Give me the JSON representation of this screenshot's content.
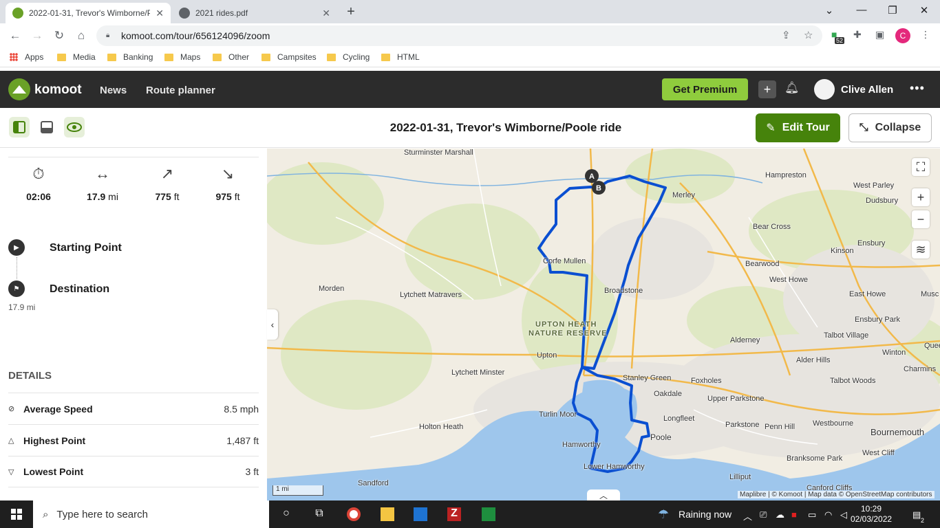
{
  "browser": {
    "tabs": [
      {
        "title": "2022-01-31, Trevor's Wimborne/P",
        "active": true
      },
      {
        "title": "2021 rides.pdf",
        "active": false
      }
    ],
    "url": "komoot.com/tour/656124096/zoom",
    "extension_badge": "52",
    "profile_initial": "C",
    "bookmarks": [
      "Apps",
      "Media",
      "Banking",
      "Maps",
      "Other",
      "Campsites",
      "Cycling",
      "HTML"
    ]
  },
  "komoot": {
    "brand": "komoot",
    "nav": [
      "News",
      "Route planner"
    ],
    "premium_label": "Get Premium",
    "user_name": "Clive Allen",
    "brand_color": "#6aa127"
  },
  "tour": {
    "title": "2022-01-31, Trevor's Wimborne/Poole ride",
    "edit_label": "Edit Tour",
    "collapse_label": "Collapse",
    "stats": {
      "duration": "02:06",
      "distance_value": "17.9",
      "distance_unit": "mi",
      "up_value": "775",
      "up_unit": "ft",
      "down_value": "975",
      "down_unit": "ft"
    },
    "waypoints": {
      "start_label": "Starting Point",
      "dest_label": "Destination",
      "dest_distance": "17.9 mi"
    },
    "details": {
      "heading": "DETAILS",
      "rows": [
        {
          "label": "Average Speed",
          "value": "8.5 mph",
          "icon": "speed-icon"
        },
        {
          "label": "Highest Point",
          "value": "1,487 ft",
          "icon": "triangle-up-icon"
        },
        {
          "label": "Lowest Point",
          "value": "3 ft",
          "icon": "triangle-down-icon"
        }
      ]
    }
  },
  "map": {
    "labels": [
      "Sturminster Marshall",
      "Hampreston",
      "West Parley",
      "Dudsbury",
      "Merley",
      "Bear Cross",
      "Kinson",
      "Ensbury",
      "Corfe Mullen",
      "Bearwood",
      "West Howe",
      "Morden",
      "Lytchett Matravers",
      "Broadstone",
      "East Howe",
      "Musc",
      "UPTON HEATH",
      "NATURE RESERVE",
      "Ensbury Park",
      "Alderney",
      "Talbot Village",
      "Upton",
      "Alder Hills",
      "Winton",
      "Quee",
      "Lytchett Minster",
      "Stanley Green",
      "Foxholes",
      "Talbot Woods",
      "Charmins",
      "Oakdale",
      "Upper Parkstone",
      "Longfleet",
      "Turlin Moor",
      "Holton Heath",
      "Parkstone",
      "Westbourne",
      "Penn Hill",
      "Bournemouth",
      "Hamworthy",
      "Poole",
      "Branksome Park",
      "West Cliff",
      "Lower Hamworthy",
      "Lilliput",
      "Sandford",
      "Canford Cliffs"
    ],
    "marker_a": "A",
    "marker_b": "B",
    "scale_label": "1 mi",
    "attribution": "Maplibre | © Komoot | Map data © OpenStreetMap contributors",
    "route_color": "#0a4fd1"
  },
  "taskbar": {
    "search_placeholder": "Type here to search",
    "weather": "Raining now",
    "time": "10:29",
    "date": "02/03/2022",
    "notifications": "2"
  }
}
